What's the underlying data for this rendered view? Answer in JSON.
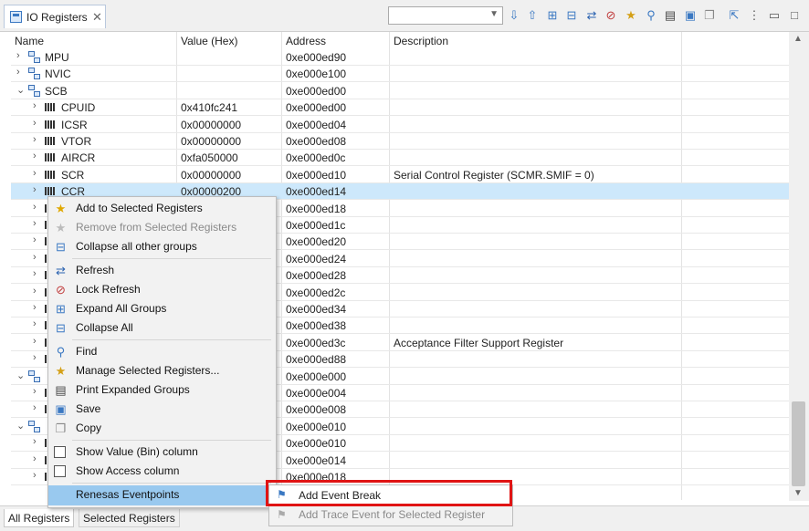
{
  "view_tab": {
    "title": "IO Registers",
    "close": "✕"
  },
  "toolbar": {
    "filter_value": "",
    "icons": [
      "arrow-down-icon",
      "arrow-up-icon",
      "expand-all-icon",
      "collapse-all-icon",
      "refresh-icon",
      "lock-refresh-icon",
      "manage-icon",
      "find-icon",
      "print-icon",
      "save-icon",
      "copy-icon",
      "export-icon",
      "view-menu-icon",
      "minimize-icon",
      "maximize-icon"
    ]
  },
  "columns": {
    "name": "Name",
    "value": "Value (Hex)",
    "address": "Address",
    "description": "Description"
  },
  "rows": [
    {
      "name": "MPU",
      "value": "",
      "address": "0xe000ed90",
      "description": ""
    },
    {
      "name": "NVIC",
      "value": "",
      "address": "0xe000e100",
      "description": ""
    },
    {
      "name": "SCB",
      "value": "",
      "address": "0xe000ed00",
      "description": ""
    },
    {
      "name": "CPUID",
      "value": "0x410fc241",
      "address": "0xe000ed00",
      "description": ""
    },
    {
      "name": "ICSR",
      "value": "0x00000000",
      "address": "0xe000ed04",
      "description": ""
    },
    {
      "name": "VTOR",
      "value": "0x00000000",
      "address": "0xe000ed08",
      "description": ""
    },
    {
      "name": "AIRCR",
      "value": "0xfa050000",
      "address": "0xe000ed0c",
      "description": ""
    },
    {
      "name": "SCR",
      "value": "0x00000000",
      "address": "0xe000ed10",
      "description": "Serial Control Register (SCMR.SMIF = 0)"
    },
    {
      "name": "CCR",
      "value": "0x00000200",
      "address": "0xe000ed14",
      "description": ""
    },
    {
      "name": "",
      "value": "",
      "address": "0xe000ed18",
      "description": ""
    },
    {
      "name": "",
      "value": "",
      "address": "0xe000ed1c",
      "description": ""
    },
    {
      "name": "",
      "value": "",
      "address": "0xe000ed20",
      "description": ""
    },
    {
      "name": "",
      "value": "",
      "address": "0xe000ed24",
      "description": ""
    },
    {
      "name": "",
      "value": "",
      "address": "0xe000ed28",
      "description": ""
    },
    {
      "name": "",
      "value": "",
      "address": "0xe000ed2c",
      "description": ""
    },
    {
      "name": "",
      "value": "",
      "address": "0xe000ed34",
      "description": ""
    },
    {
      "name": "",
      "value": "",
      "address": "0xe000ed38",
      "description": ""
    },
    {
      "name": "",
      "value": "",
      "address": "0xe000ed3c",
      "description": "Acceptance Filter Support Register"
    },
    {
      "name": "",
      "value": "",
      "address": "0xe000ed88",
      "description": ""
    },
    {
      "name": "",
      "value": "",
      "address": "0xe000e000",
      "description": ""
    },
    {
      "name": "",
      "value": "",
      "address": "0xe000e004",
      "description": ""
    },
    {
      "name": "",
      "value": "",
      "address": "0xe000e008",
      "description": ""
    },
    {
      "name": "",
      "value": "",
      "address": "0xe000e010",
      "description": ""
    },
    {
      "name": "",
      "value": "",
      "address": "0xe000e010",
      "description": ""
    },
    {
      "name": "",
      "value": "",
      "address": "0xe000e014",
      "description": ""
    },
    {
      "name": "",
      "value": "",
      "address": "0xe000e018",
      "description": ""
    }
  ],
  "context_menu": {
    "items": [
      "Add to Selected Registers",
      "Remove from Selected Registers",
      "Collapse all other groups",
      "Refresh",
      "Lock Refresh",
      "Expand All Groups",
      "Collapse All",
      "Find",
      "Manage Selected Registers...",
      "Print Expanded Groups",
      "Save",
      "Copy",
      "Show Value (Bin) column",
      "Show Access column",
      "Renesas Eventpoints"
    ]
  },
  "submenu": {
    "add_event_break": "Add Event Break",
    "add_trace_event": "Add Trace Event for Selected Register"
  },
  "bottom_tabs": {
    "all": "All Registers",
    "selected": "Selected Registers"
  },
  "colors": {
    "selection": "#cde8fb",
    "menu_highlight": "#99c9ef",
    "callout": "#e01414"
  }
}
